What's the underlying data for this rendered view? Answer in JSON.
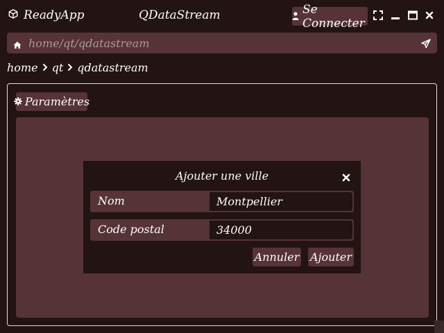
{
  "app": {
    "name": "ReadyApp",
    "window_title": "QDataStream",
    "login_label": "Se Connecter",
    "icons": {
      "app": "cube-icon",
      "login": "user-icon",
      "fullscreen": "expand-icon",
      "minimize": "minimize-icon",
      "maximize": "maximize-icon",
      "close": "close-icon"
    }
  },
  "address": {
    "placeholder": "home/qt/qdatastream",
    "icons": {
      "home": "home-icon",
      "send": "paper-plane-icon"
    }
  },
  "breadcrumb": {
    "items": [
      "home",
      "qt",
      "qdatastream"
    ]
  },
  "panel": {
    "tab_label": "Paramètres",
    "tab_icon": "gear-icon"
  },
  "dialog": {
    "title": "Ajouter une ville",
    "fields": [
      {
        "label": "Nom",
        "value": "Montpellier"
      },
      {
        "label": "Code postal",
        "value": "34000"
      }
    ],
    "cancel_label": "Annuler",
    "add_label": "Ajouter"
  },
  "colors": {
    "background": "#231313",
    "surface": "#553337",
    "text": "#ffffff",
    "muted_text": "#a99a9b",
    "panel_border": "#e8dcdc"
  }
}
